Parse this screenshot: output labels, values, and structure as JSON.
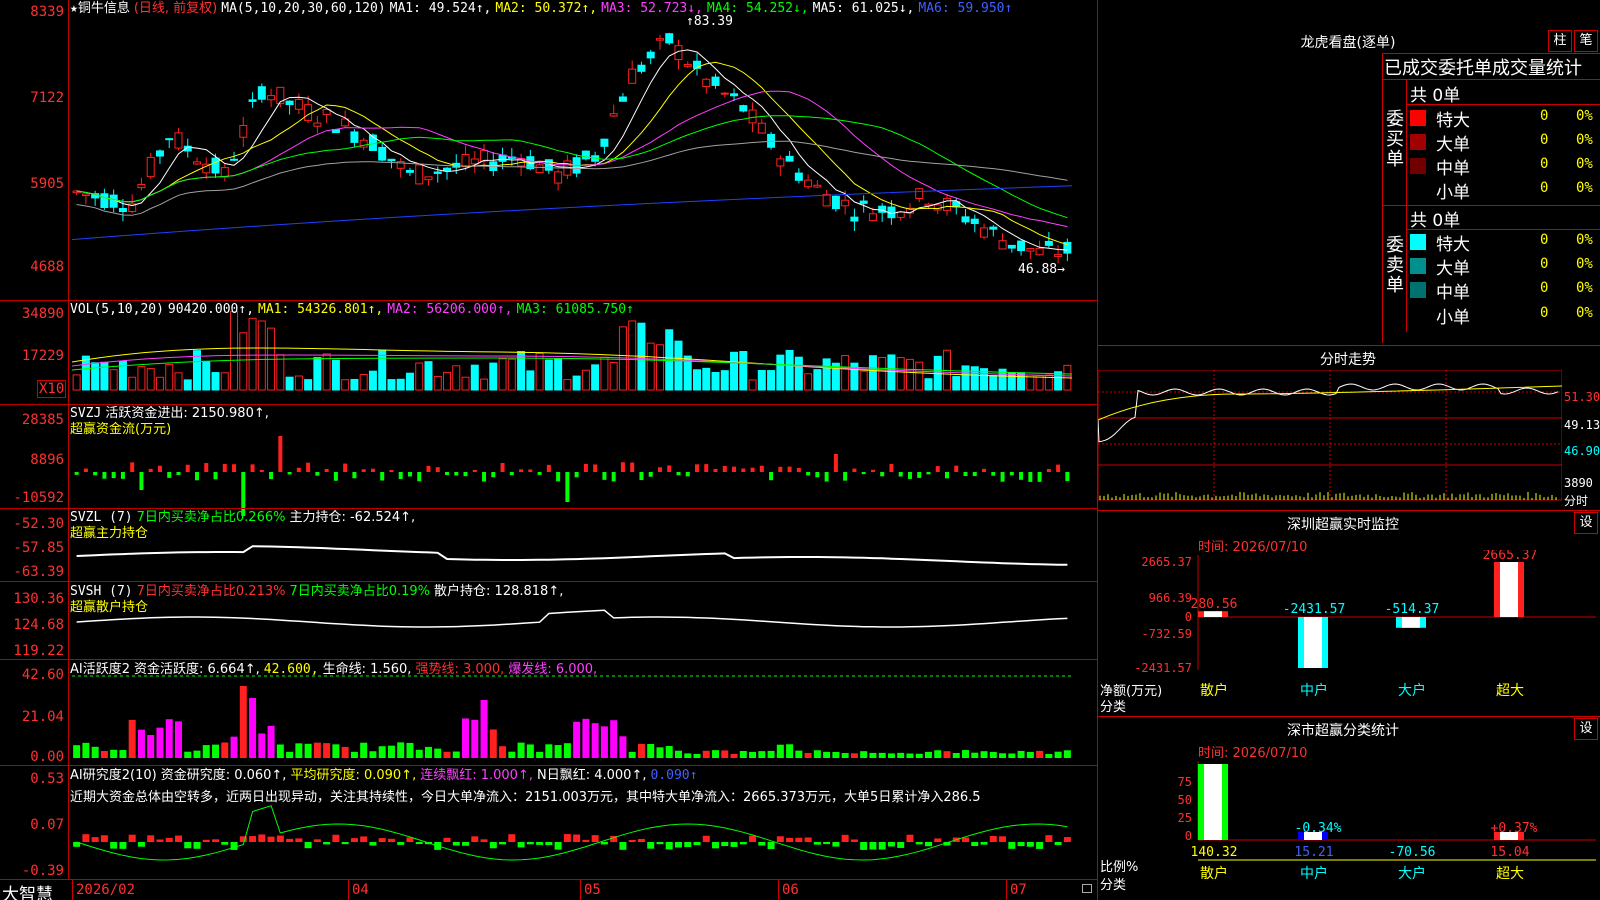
{
  "app": {
    "brand": "大智慧"
  },
  "kline": {
    "title_star": "★",
    "stock_name": "铜牛信息",
    "mode": "(日线, 前复权)",
    "ma_spec": "MA(5,10,20,30,60,120)",
    "ma1": "MA1: 49.524↑,",
    "ma2": "MA2: 50.372↑,",
    "ma3": "MA3: 52.723↓,",
    "ma4": "MA4: 54.252↓,",
    "ma5": "MA5: 61.025↓,",
    "ma6": "MA6: 59.950↑",
    "y_ticks": [
      "8339",
      "7122",
      "5905",
      "4688"
    ],
    "high_mark": "83.39",
    "low_mark": "46.88→",
    "colors": {
      "up": "#ff2020",
      "down": "#00ffff",
      "ma1": "#ffffff",
      "ma2": "#ffff00",
      "ma3": "#ff40ff",
      "ma4": "#00ff00",
      "ma5": "#a0a0a0",
      "ma6": "#2040ff"
    }
  },
  "vol": {
    "label": "VOL(5,10,20)",
    "value": "90420.000↑,",
    "ma1": "MA1: 54326.801↑,",
    "ma2": "MA2: 56206.000↑,",
    "ma3": "MA3: 61085.750↑",
    "y_ticks": [
      "34890",
      "17229"
    ],
    "unit": "X10"
  },
  "svzj": {
    "label": "SVZJ",
    "text": "活跃资金进出: 2150.980↑,",
    "title": "超赢资金流(万元)",
    "y_ticks": [
      "28385",
      "8896",
      "-10592"
    ]
  },
  "svzl": {
    "label": "SVZL (7)",
    "part1": "7日内买卖净占比0.266%",
    "part2": "主力持仓: -62.524↑,",
    "title": "超赢主力持仓",
    "y_ticks": [
      "-52.30",
      "-57.85",
      "-63.39"
    ]
  },
  "svsh": {
    "label": "SVSH (7)",
    "part1": "7日内买卖净占比0.213%",
    "part2": "7日内买卖净占比0.19%",
    "part3": "散户持仓: 128.818↑,",
    "title": "超赢散户持仓",
    "y_ticks": [
      "130.36",
      "124.68",
      "119.22"
    ]
  },
  "ai1": {
    "label": "AI活跃度2",
    "t1": "资金活跃度: 6.664↑,",
    "t2": "42.600,",
    "t3": "生命线: 1.560,",
    "t4": "强势线: 3.000,",
    "t5": "爆发线: 6.000,",
    "y_ticks": [
      "42.60",
      "21.04",
      "0.00"
    ]
  },
  "ai2": {
    "label": "AI研究度2(10)",
    "t1": "资金研究度: 0.060↑,",
    "t2": "平均研究度: 0.090↑,",
    "t3": "连续飘红: 1.000↑,",
    "t4": "N日飘红: 4.000↑,",
    "t5": "0.090↑",
    "comment": "近期大资金总体由空转多，近两日出现异动，关注其持续性，今日大单净流入：2151.003万元，其中特大单净流入：2665.373万元，大单5日累计净入286.5",
    "y_ticks": [
      "0.53",
      "0.07",
      "-0.39"
    ]
  },
  "x_axis": [
    "2026/02",
    "04",
    "05",
    "06",
    "07"
  ],
  "lhb": {
    "title": "龙虎看盘(逐单)",
    "btn1": "柱",
    "btn2": "笔",
    "header": "已成交委托单成交量统计",
    "buy_label": "委买单",
    "sell_label": "委卖单",
    "buy_total": "共 0单",
    "sell_total": "共 0单",
    "buy_rows": [
      {
        "name": "特大",
        "count": "0",
        "pct": "0%",
        "color": "#ff0000"
      },
      {
        "name": "大单",
        "count": "0",
        "pct": "0%",
        "color": "#a00000"
      },
      {
        "name": "中单",
        "count": "0",
        "pct": "0%",
        "color": "#700000"
      },
      {
        "name": "小单",
        "count": "0",
        "pct": "0%",
        "color": ""
      }
    ],
    "sell_rows": [
      {
        "name": "特大",
        "count": "0",
        "pct": "0%",
        "color": "#00ffff"
      },
      {
        "name": "大单",
        "count": "0",
        "pct": "0%",
        "color": "#009090"
      },
      {
        "name": "中单",
        "count": "0",
        "pct": "0%",
        "color": "#007070"
      },
      {
        "name": "小单",
        "count": "0",
        "pct": "0%",
        "color": ""
      }
    ]
  },
  "intraday": {
    "title": "分时走势",
    "y_ticks": [
      "51.30",
      "49.13",
      "46.90"
    ],
    "vol_tick": "3890",
    "vol_unit": "分时"
  },
  "sz_monitor": {
    "title": "深圳超赢实时监控",
    "btn": "设",
    "time": "时间: 2026/07/10",
    "y_ticks": [
      "2665.37",
      "966.39",
      "0",
      "-732.59",
      "-2431.57"
    ],
    "y_title": "净额(万元)",
    "x_title": "分类",
    "categories": [
      "散户",
      "中户",
      "大户",
      "超大"
    ],
    "values": [
      280.56,
      -2431.57,
      -514.37,
      2665.37
    ],
    "value_labels": [
      "280.56",
      "-2431.57",
      "-514.37",
      "2665.37"
    ]
  },
  "sz_class": {
    "title": "深市超赢分类统计",
    "btn": "设",
    "time": "时间: 2026/07/10",
    "y_ticks": [
      "75",
      "50",
      "25",
      "0"
    ],
    "y_title": "比例%",
    "x_title": "分类",
    "categories": [
      "散户",
      "中户",
      "大户",
      "超大"
    ],
    "pct_labels": [
      "",
      "-0.34%",
      "",
      "+0.37%"
    ],
    "values": [
      "140.32",
      "15.21",
      "-70.56",
      "15.04"
    ]
  }
}
